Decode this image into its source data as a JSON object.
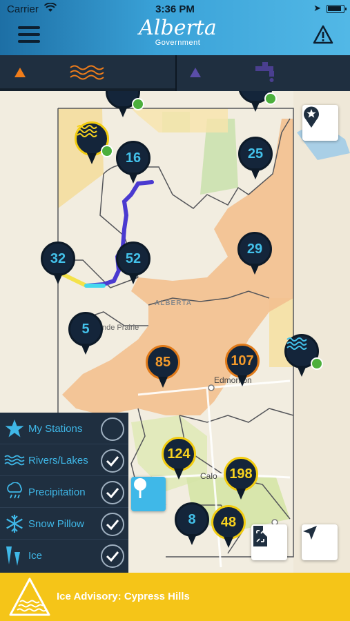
{
  "status_bar": {
    "carrier": "Carrier",
    "time": "3:36 PM"
  },
  "header": {
    "logo_text": "Alberta",
    "logo_subtext": "Government"
  },
  "tabs": [
    {
      "name": "rivers-lakes",
      "active": true,
      "color": "#f07d1a"
    },
    {
      "name": "water-supply",
      "active": false,
      "color": "#5a4da8"
    }
  ],
  "map": {
    "labels": {
      "region": "ALBERTA",
      "city1": "Grande Prairie",
      "city1_visible": "nde Prairie",
      "city2": "Edmonton",
      "city3": "Calgary",
      "city3_visible": "Calo"
    },
    "station_pins": [
      {
        "count": "16",
        "style": "blue"
      },
      {
        "count": "25",
        "style": "blue"
      },
      {
        "count": "32",
        "style": "blue"
      },
      {
        "count": "52",
        "style": "blue"
      },
      {
        "count": "29",
        "style": "blue"
      },
      {
        "count": "5",
        "style": "blue"
      },
      {
        "count": "85",
        "style": "orange"
      },
      {
        "count": "107",
        "style": "orange"
      },
      {
        "count": "124",
        "style": "yellow"
      },
      {
        "count": "198",
        "style": "yellow"
      },
      {
        "count": "8",
        "style": "blue"
      },
      {
        "count": "48",
        "style": "yellow"
      }
    ]
  },
  "layers": [
    {
      "label": "My Stations",
      "checked": false,
      "icon": "star-icon"
    },
    {
      "label": "Rivers/Lakes",
      "checked": true,
      "icon": "waves-icon"
    },
    {
      "label": "Precipitation",
      "checked": true,
      "icon": "rain-icon"
    },
    {
      "label": "Snow Pillow",
      "checked": true,
      "icon": "snowflake-icon"
    },
    {
      "label": "Ice",
      "checked": true,
      "icon": "ice-icon"
    }
  ],
  "advisory": {
    "text": "Ice Advisory:  Cypress Hills"
  },
  "colors": {
    "accent": "#3fb8e8",
    "panel": "#1f2f40",
    "advisory": "#f5c518",
    "orange": "#e07a19",
    "yellow": "#f2cc10"
  }
}
